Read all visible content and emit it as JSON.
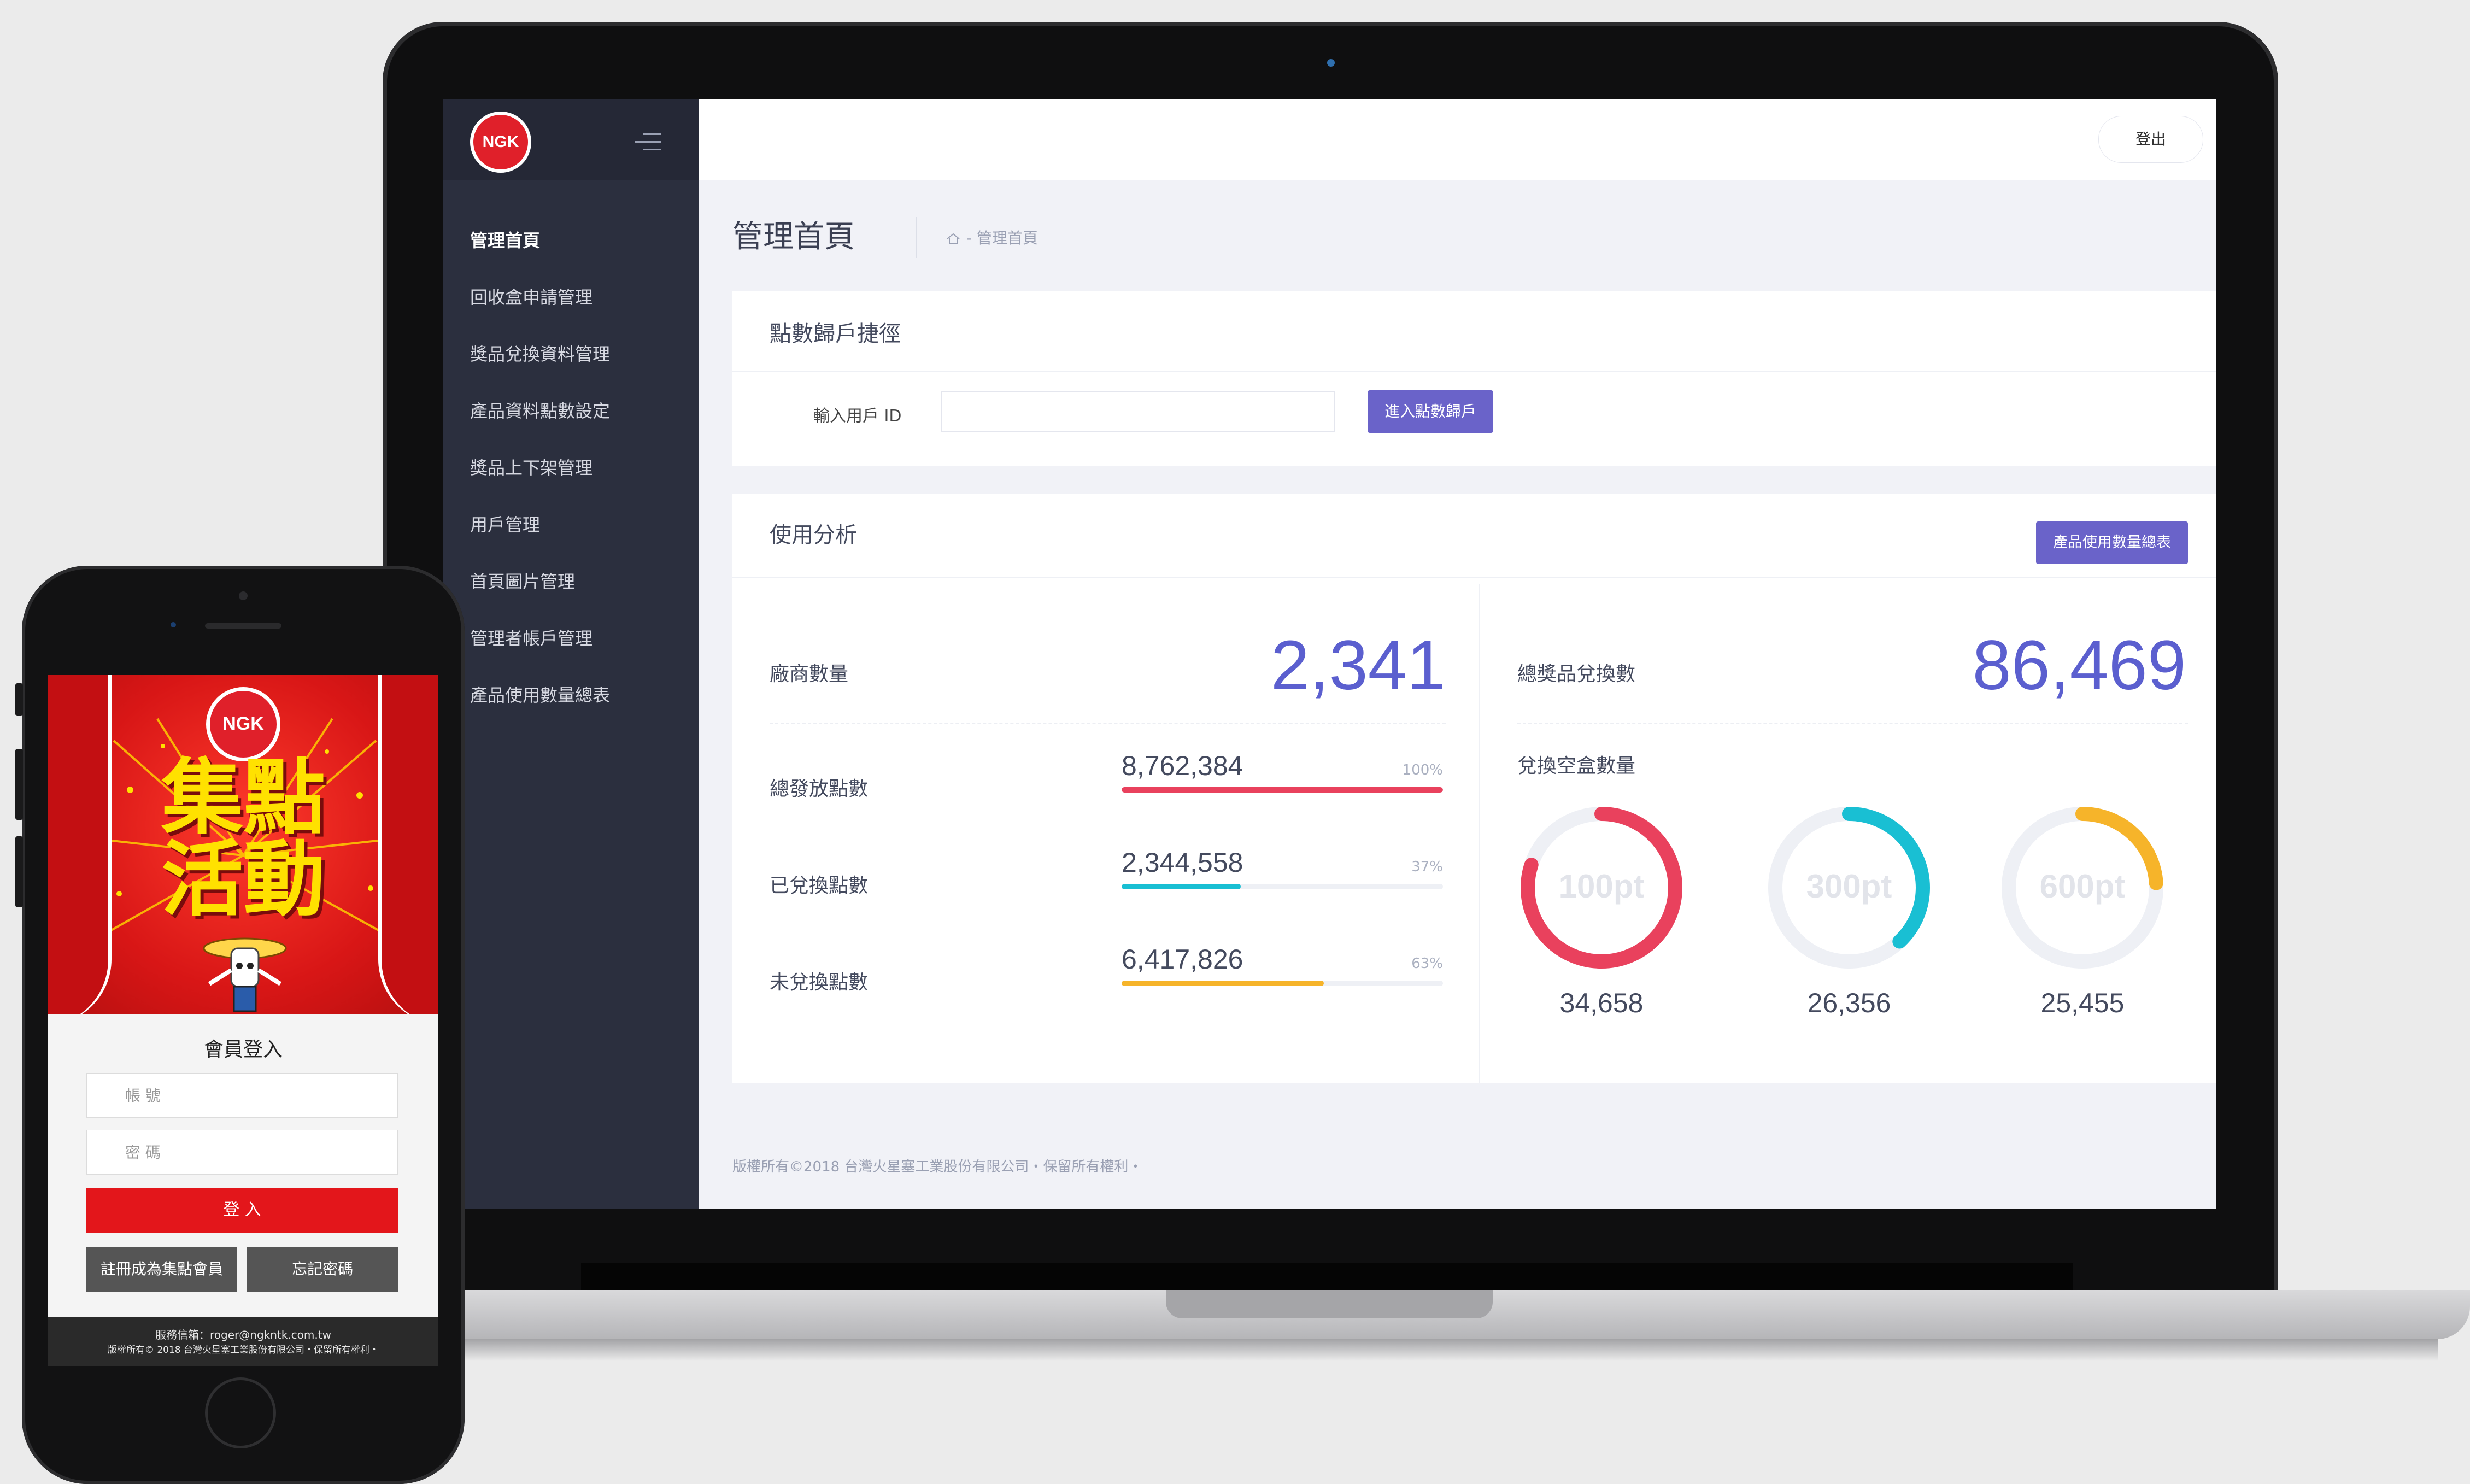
{
  "laptop": {
    "logo_text": "NGK",
    "logout_label": "登出",
    "sidebar_items": [
      "管理首頁",
      "回收盒申請管理",
      "獎品兌換資料管理",
      "產品資料點數設定",
      "獎品上下架管理",
      "用戶管理",
      "首頁圖片管理",
      "管理者帳戶管理",
      "產品使用數量總表"
    ],
    "page_title": "管理首頁",
    "breadcrumb": "- 管理首頁",
    "shortcut_card": {
      "title": "點數歸戶捷徑",
      "input_label": "輸入用戶 ID",
      "input_value": "",
      "button_label": "進入點數歸戶"
    },
    "analysis_card": {
      "title": "使用分析",
      "report_button": "產品使用數量總表",
      "vendors_label": "廠商數量",
      "vendors_value": "2,341",
      "redemptions_label": "總獎品兌換數",
      "redemptions_value": "86,469",
      "points": [
        {
          "label": "總發放點數",
          "value": "8,762,384",
          "pct_label": "100%",
          "pct": 100,
          "color": "#e9415d"
        },
        {
          "label": "已兌換點數",
          "value": "2,344,558",
          "pct_label": "37%",
          "pct": 37,
          "color": "#19bfd3"
        },
        {
          "label": "未兌換點數",
          "value": "6,417,826",
          "pct_label": "63%",
          "pct": 63,
          "color": "#f6b42a"
        }
      ],
      "boxes_label": "兌換空盒數量",
      "boxes": [
        {
          "center": "100pt",
          "count": "34,658",
          "fraction": 0.8,
          "color": "#e9415d"
        },
        {
          "center": "300pt",
          "count": "26,356",
          "fraction": 0.38,
          "color": "#19bfd3"
        },
        {
          "center": "600pt",
          "count": "25,455",
          "fraction": 0.24,
          "color": "#f6b42a"
        }
      ]
    },
    "footer": "版權所有©2018 台灣火星塞工業股份有限公司・保留所有權利・"
  },
  "phone": {
    "logo_text": "NGK",
    "banner_title_line1": "集點",
    "banner_title_line2": "活動",
    "login_title": "會員登入",
    "account_placeholder": "帳 號",
    "password_placeholder": "密 碼",
    "login_button": "登 入",
    "register_button": "註冊成為集點會員",
    "forgot_button": "忘記密碼",
    "footer_line1": "服務信箱：roger@ngkntk.com.tw",
    "footer_line2": "版權所有© 2018 台灣火星塞工業股份有限公司・保留所有權利・"
  }
}
